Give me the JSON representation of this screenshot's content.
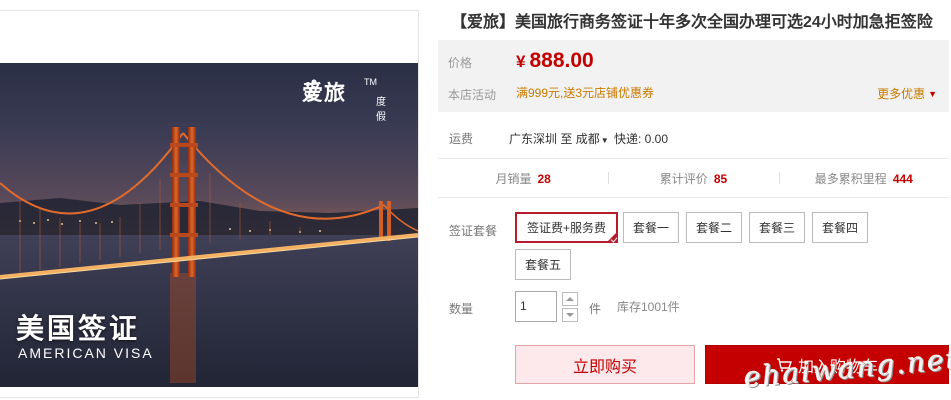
{
  "product": {
    "title": "【爱旅】美国旅行商务签证十年多次全国办理可选24小时加急拒签险",
    "image": {
      "brand_name": "爱旅",
      "brand_tm": "TM",
      "brand_sub": "度假",
      "caption_cn": "美国签证",
      "caption_en": "AMERICAN VISA"
    }
  },
  "price": {
    "label": "价格",
    "currency": "¥",
    "value": "888.00"
  },
  "promotion": {
    "label": "本店活动",
    "text": "满999元,送3元店铺优惠券",
    "more_label": "更多优惠"
  },
  "shipping": {
    "label": "运费",
    "from": "广东深圳",
    "to_prefix": "至",
    "to": "成都",
    "method": "快递: 0.00"
  },
  "stats": [
    {
      "label": "月销量",
      "value": "28"
    },
    {
      "label": "累计评价",
      "value": "85"
    },
    {
      "label": "最多累积里程",
      "value": "444"
    }
  ],
  "packages": {
    "label": "签证套餐",
    "options": [
      "签证费+服务费",
      "套餐一",
      "套餐二",
      "套餐三",
      "套餐四",
      "套餐五"
    ],
    "selected_index": 0
  },
  "quantity": {
    "label": "数量",
    "value": "1",
    "unit": "件",
    "stock": "库存1001件"
  },
  "actions": {
    "buy_now": "立即购买",
    "add_to_cart": "加入购物车"
  },
  "watermark": "ehaiwang.net",
  "colors": {
    "accent": "#c40000",
    "promo": "#c87a00",
    "price_bg": "#f2f2f2",
    "buy_now_bg": "#fde9eb"
  }
}
